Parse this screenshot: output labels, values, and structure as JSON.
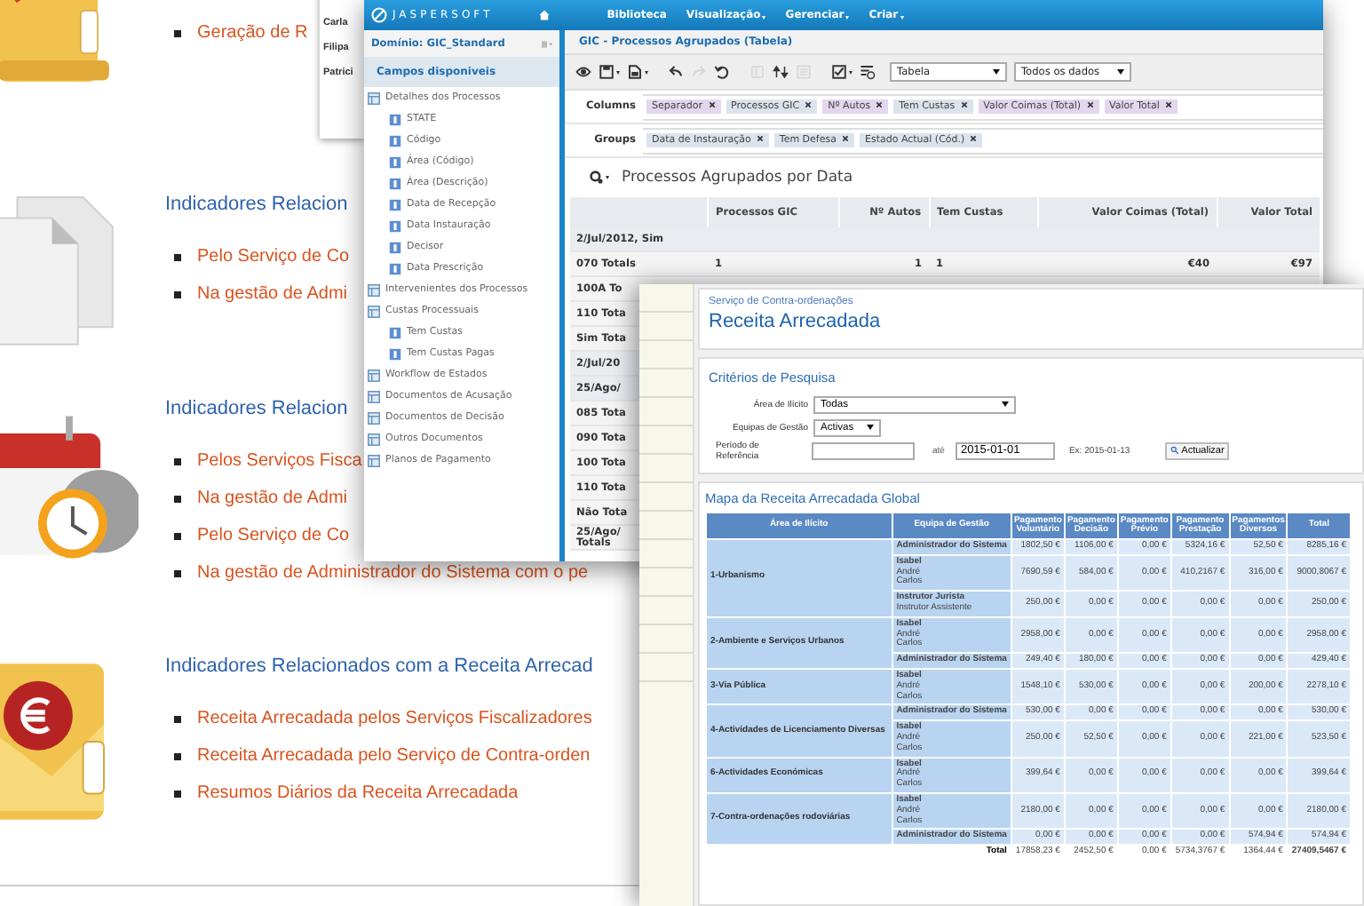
{
  "page": {
    "sections": [
      {
        "links": [
          "Geração de R"
        ]
      },
      {
        "heading": "Indicadores Relacion",
        "links": [
          "Pelo Serviço de Co",
          "Na gestão de Admi"
        ]
      },
      {
        "heading": "Indicadores Relacion",
        "links": [
          "Pelos Serviços Fisca",
          "Na gestão de Admi",
          "Pelo Serviço de Co",
          "Na gestão de Administrador do Sistema com o pe"
        ]
      },
      {
        "heading": "Indicadores Relacionados com a Receita Arrecad",
        "links": [
          "Receita Arrecadada pelos Serviços Fiscalizadores",
          "Receita Arrecadada pelo Serviço de Contra-orden",
          "Resumos Diários da Receita Arrecadada"
        ]
      }
    ]
  },
  "popup_list": [
    "Carla",
    "Filipa",
    "Patrici"
  ],
  "jasper": {
    "brand": "JASPERSOFT",
    "menu": [
      {
        "label": "Biblioteca",
        "dropdown": false
      },
      {
        "label": "Visualização",
        "dropdown": true
      },
      {
        "label": "Gerenciar",
        "dropdown": true
      },
      {
        "label": "Criar",
        "dropdown": true
      }
    ],
    "domain": "Domínio: GIC_Standard",
    "fields_title": "Campos disponiveis",
    "tree": [
      {
        "label": "Detalhes dos Processos",
        "kind": "group",
        "children": [
          {
            "label": "STATE",
            "kind": "field"
          },
          {
            "label": "Código",
            "kind": "field"
          },
          {
            "label": "Área (Código)",
            "kind": "field"
          },
          {
            "label": "Área (Descrição)",
            "kind": "field"
          },
          {
            "label": "Data de Recepção",
            "kind": "field"
          },
          {
            "label": "Data Instauração",
            "kind": "field"
          },
          {
            "label": "Decisor",
            "kind": "field"
          },
          {
            "label": "Data Prescrição",
            "kind": "field"
          }
        ]
      },
      {
        "label": "Intervenientes dos Processos",
        "kind": "group"
      },
      {
        "label": "Custas Processuais",
        "kind": "group",
        "children": [
          {
            "label": "Tem Custas",
            "kind": "field"
          },
          {
            "label": "Tem Custas Pagas",
            "kind": "field"
          }
        ]
      },
      {
        "label": "Workflow de Estados",
        "kind": "group"
      },
      {
        "label": "Documentos de Acusação",
        "kind": "group"
      },
      {
        "label": "Documentos de Decisão",
        "kind": "group"
      },
      {
        "label": "Outros Documentos",
        "kind": "group"
      },
      {
        "label": "Planos de Pagamento",
        "kind": "group"
      }
    ],
    "view_title": "GIC - Processos Agrupados (Tabela)",
    "toolbar": [
      {
        "kind": "eye",
        "disabled": false,
        "menu": false
      },
      {
        "kind": "save",
        "disabled": false,
        "menu": true
      },
      {
        "kind": "export",
        "disabled": false,
        "menu": true
      },
      {
        "kind": "undo",
        "disabled": false,
        "menu": false
      },
      {
        "kind": "redo",
        "disabled": true,
        "menu": false
      },
      {
        "kind": "reset",
        "disabled": false,
        "menu": false
      },
      {
        "kind": "pivot",
        "disabled": true,
        "menu": false
      },
      {
        "kind": "sort",
        "disabled": false,
        "menu": false
      },
      {
        "kind": "sheet",
        "disabled": true,
        "menu": false
      },
      {
        "kind": "check",
        "disabled": false,
        "menu": true
      },
      {
        "kind": "filter",
        "disabled": false,
        "menu": false
      }
    ],
    "view_select": "Tabela",
    "data_select": "Todos os dados",
    "columns_label": "Columns",
    "columns": [
      {
        "label": "Separador",
        "color": "#e3d6ee"
      },
      {
        "label": "Processos GIC",
        "color": "#dde3ec"
      },
      {
        "label": "Nº Autos",
        "color": "#e3d6ee"
      },
      {
        "label": "Tem Custas",
        "color": "#dde3ec"
      },
      {
        "label": "Valor Coimas (Total)",
        "color": "#e3d6ee"
      },
      {
        "label": "Valor Total",
        "color": "#e3d6ee"
      }
    ],
    "groups_label": "Groups",
    "groups": [
      {
        "label": "Data de Instauração",
        "color": "#dde3ec"
      },
      {
        "label": "Tem Defesa",
        "color": "#dde3ec"
      },
      {
        "label": "Estado Actual (Cód.)",
        "color": "#dde3ec"
      }
    ],
    "table_title": "Processos Agrupados por Data",
    "table": {
      "columns": [
        "",
        "Processos GIC",
        "Nº Autos",
        "Tem Custas",
        "Valor Coimas (Total)",
        "Valor Total"
      ],
      "rows": [
        {
          "kind": "group",
          "cells": [
            "2/Jul/2012, Sim"
          ]
        },
        {
          "kind": "total",
          "cells": [
            "070 Totals",
            "1",
            "1",
            "1",
            "€40",
            "€97"
          ]
        },
        {
          "kind": "total",
          "cells": [
            "100A To"
          ]
        },
        {
          "kind": "total",
          "cells": [
            "110 Tota"
          ]
        },
        {
          "kind": "total",
          "cells": [
            "Sim Tota"
          ]
        },
        {
          "kind": "group",
          "cells": [
            "2/Jul/20"
          ]
        },
        {
          "kind": "group",
          "cells": [
            "25/Ago/"
          ]
        },
        {
          "kind": "total",
          "cells": [
            "085 Tota"
          ]
        },
        {
          "kind": "total",
          "cells": [
            "090 Tota"
          ]
        },
        {
          "kind": "total",
          "cells": [
            "100 Tota"
          ]
        },
        {
          "kind": "total",
          "cells": [
            "110 Tota"
          ]
        },
        {
          "kind": "total",
          "cells": [
            "Não Tota"
          ]
        },
        {
          "kind": "total",
          "cells": [
            "25/Ago/ Totals"
          ]
        }
      ]
    }
  },
  "receita": {
    "breadcrumb": "Serviço de Contra-ordenações",
    "title": "Receita Arrecadada",
    "criteria_title": "Critérios de Pesquisa",
    "area_label": "Área de Ilícito",
    "area_value": "Todas",
    "teams_label": "Equipas de Gestão",
    "teams_value": "Activas",
    "period_label": "Período de Referência",
    "until_label": "até",
    "until_value": "2015-01-01",
    "example": "Ex: 2015-01-13",
    "update_button": "Actualizar",
    "map_title": "Mapa da Receita Arrecadada Global",
    "table": {
      "columns": [
        "Área de Ilícito",
        "Equipa de Gestão",
        "Pagamento Voluntário",
        "Pagamento Decisão",
        "Pagamento Prévio",
        "Pagamento Prestação",
        "Pagamentos Diversos",
        "Total"
      ],
      "areas": [
        {
          "name": "1-Urbanismo",
          "rows": [
            {
              "team": [
                "Administrador do Sistema"
              ],
              "values": [
                "1802,50 €",
                "1106,00 €",
                "0,00 €",
                "5324,16 €",
                "52,50 €",
                "8285,16 €"
              ]
            },
            {
              "team": [
                "Isabel",
                "André",
                "Carlos"
              ],
              "values": [
                "7690,59 €",
                "584,00 €",
                "0,00 €",
                "410,2167 €",
                "316,00 €",
                "9000,8067 €"
              ]
            },
            {
              "team": [
                "Instrutor Jurista",
                "Instrutor Assistente"
              ],
              "values": [
                "250,00 €",
                "0,00 €",
                "0,00 €",
                "0,00 €",
                "0,00 €",
                "250,00 €"
              ]
            }
          ]
        },
        {
          "name": "2-Ambiente e Serviços Urbanos",
          "rows": [
            {
              "team": [
                "Isabel",
                "André",
                "Carlos"
              ],
              "values": [
                "2958,00 €",
                "0,00 €",
                "0,00 €",
                "0,00 €",
                "0,00 €",
                "2958,00 €"
              ]
            },
            {
              "team": [
                "Administrador do Sistema"
              ],
              "values": [
                "249,40 €",
                "180,00 €",
                "0,00 €",
                "0,00 €",
                "0,00 €",
                "429,40 €"
              ]
            }
          ]
        },
        {
          "name": "3-Via Pública",
          "rows": [
            {
              "team": [
                "Isabel",
                "André",
                "Carlos"
              ],
              "values": [
                "1548,10 €",
                "530,00 €",
                "0,00 €",
                "0,00 €",
                "200,00 €",
                "2278,10 €"
              ]
            }
          ]
        },
        {
          "name": "4-Actividades de Licenciamento Diversas",
          "rows": [
            {
              "team": [
                "Administrador do Sistema"
              ],
              "values": [
                "530,00 €",
                "0,00 €",
                "0,00 €",
                "0,00 €",
                "0,00 €",
                "530,00 €"
              ]
            },
            {
              "team": [
                "Isabel",
                "André",
                "Carlos"
              ],
              "values": [
                "250,00 €",
                "52,50 €",
                "0,00 €",
                "0,00 €",
                "221,00 €",
                "523,50 €"
              ]
            }
          ]
        },
        {
          "name": "6-Actividades Económicas",
          "rows": [
            {
              "team": [
                "Isabel",
                "André",
                "Carlos"
              ],
              "values": [
                "399,64 €",
                "0,00 €",
                "0,00 €",
                "0,00 €",
                "0,00 €",
                "399,64 €"
              ]
            }
          ]
        },
        {
          "name": "7-Contra-ordenações rodoviárias",
          "rows": [
            {
              "team": [
                "Isabel",
                "André",
                "Carlos"
              ],
              "values": [
                "2180,00 €",
                "0,00 €",
                "0,00 €",
                "0,00 €",
                "0,00 €",
                "2180,00 €"
              ]
            },
            {
              "team": [
                "Administrador do Sistema"
              ],
              "values": [
                "0,00 €",
                "0,00 €",
                "0,00 €",
                "0,00 €",
                "574,94 €",
                "574,94 €"
              ]
            }
          ]
        }
      ],
      "total": {
        "label": "Total",
        "values": [
          "17858,23 €",
          "2452,50 €",
          "0,00 €",
          "5734,3767 €",
          "1364,44 €",
          "27409,5467 €"
        ]
      }
    }
  }
}
